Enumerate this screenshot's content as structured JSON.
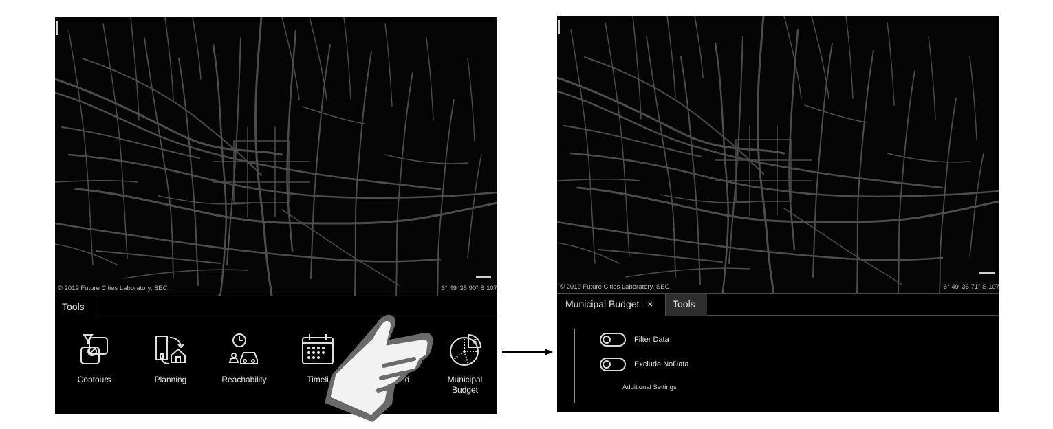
{
  "before": {
    "attribution": "© 2019 Future Cities Laboratory, SEC",
    "coordinates": "6° 49' 35.90\" S   107",
    "tabs": [
      {
        "label": "Tools"
      }
    ],
    "tools": [
      {
        "label": "Contours",
        "icon": "contours-icon"
      },
      {
        "label": "Planning",
        "icon": "planning-icon"
      },
      {
        "label": "Reachability",
        "icon": "reachability-icon"
      },
      {
        "label": "Timeli",
        "icon": "calendar-icon"
      },
      {
        "label": "d",
        "icon": "hidden-tool-icon"
      },
      {
        "label_line1": "Municipal",
        "label_line2": "Budget",
        "icon": "pie-chart-dollar-icon"
      }
    ]
  },
  "after": {
    "attribution": "© 2019 Future Cities Laboratory, SEC",
    "coordinates": "6° 49' 36.71\" S   107",
    "tabs": [
      {
        "label": "Municipal Budget",
        "close": "×"
      },
      {
        "label": "Tools"
      }
    ],
    "options": [
      {
        "label": "Filter Data",
        "state": "off"
      },
      {
        "label": "Exclude NoData",
        "state": "off"
      }
    ],
    "additional_settings": "Additional Settings"
  },
  "colors": {
    "map_background": "#050505",
    "roads": "#4d4d4d",
    "text": "#e6e6e6",
    "inactive_tab": "#2e2e2e"
  }
}
